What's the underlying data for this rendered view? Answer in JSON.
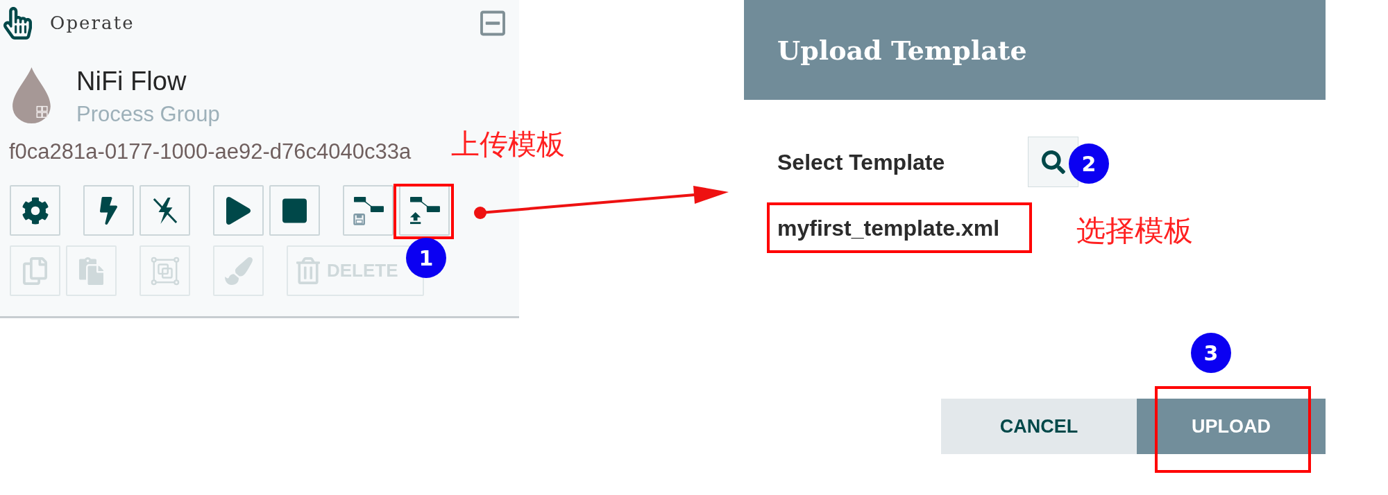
{
  "operate_panel": {
    "title": "Operate",
    "expanded": true,
    "component": {
      "name": "NiFi Flow",
      "type": "Process Group",
      "id": "f0ca281a-0177-1000-ae92-d76c4040c33a"
    },
    "toolbar_rows": [
      {
        "groups": [
          {
            "buttons": [
              {
                "kind": "configure",
                "disabled": false,
                "highlighted": false
              }
            ]
          },
          {
            "buttons": [
              {
                "kind": "enable",
                "disabled": false,
                "highlighted": false
              },
              {
                "kind": "disable",
                "disabled": false,
                "highlighted": false
              }
            ]
          },
          {
            "buttons": [
              {
                "kind": "start",
                "disabled": false,
                "highlighted": false
              },
              {
                "kind": "stop",
                "disabled": false,
                "highlighted": false
              }
            ]
          },
          {
            "buttons": [
              {
                "kind": "save_template",
                "disabled": false,
                "highlighted": false
              },
              {
                "kind": "upload_template",
                "disabled": false,
                "highlighted": true,
                "step": "1"
              }
            ]
          }
        ]
      },
      {
        "groups": [
          {
            "buttons": [
              {
                "kind": "copy",
                "disabled": true,
                "highlighted": false
              },
              {
                "kind": "paste",
                "disabled": true,
                "highlighted": false
              }
            ]
          },
          {
            "buttons": [
              {
                "kind": "group",
                "disabled": true,
                "highlighted": false
              }
            ]
          },
          {
            "buttons": [
              {
                "kind": "change_color",
                "disabled": true,
                "highlighted": false
              }
            ]
          },
          {
            "buttons": [
              {
                "kind": "delete",
                "label": "DELETE",
                "disabled": true,
                "highlighted": false
              }
            ]
          }
        ]
      }
    ],
    "note": "上传模板"
  },
  "upload_dialog": {
    "title": "Upload Template",
    "field_label": "Select Template",
    "search_button": {
      "step": "2"
    },
    "file": {
      "name": "myfirst_template.xml",
      "highlighted": true
    },
    "note": "选择模板",
    "buttons": [
      {
        "kind": "cancel",
        "label": "CANCEL",
        "highlighted": false
      },
      {
        "kind": "upload",
        "label": "UPLOAD",
        "highlighted": true,
        "step": "3"
      }
    ]
  }
}
